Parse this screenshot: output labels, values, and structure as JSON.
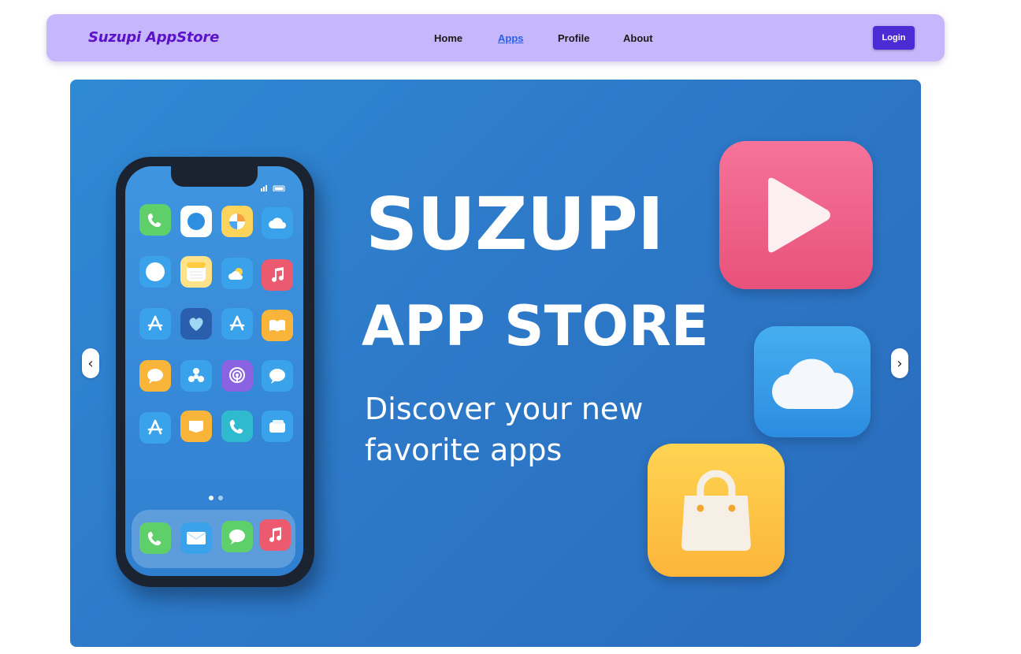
{
  "navbar": {
    "brand": "Suzupi AppStore",
    "links": [
      {
        "label": "Home",
        "active": false
      },
      {
        "label": "Apps",
        "active": true
      },
      {
        "label": "Profile",
        "active": false
      },
      {
        "label": "About",
        "active": false
      }
    ],
    "login_label": "Login"
  },
  "hero": {
    "title_line1": "SUZUPI",
    "title_line2": "APP STORE",
    "subtitle": "Discover your new favorite apps",
    "prev_arrow": "‹",
    "next_arrow": "›"
  },
  "colors": {
    "navbar_bg": "#c6b6fb",
    "brand": "#5b12c9",
    "active_link": "#2563eb",
    "login_bg": "#4a2bd4",
    "hero_bg": "#2d79c8"
  },
  "icons": [
    "play-icon",
    "cloud-icon",
    "shopping-bag-icon",
    "phone-icon",
    "music-icon",
    "heart-icon",
    "app-store-icon",
    "message-icon",
    "podcast-icon",
    "mail-icon",
    "book-icon",
    "wallet-icon"
  ]
}
